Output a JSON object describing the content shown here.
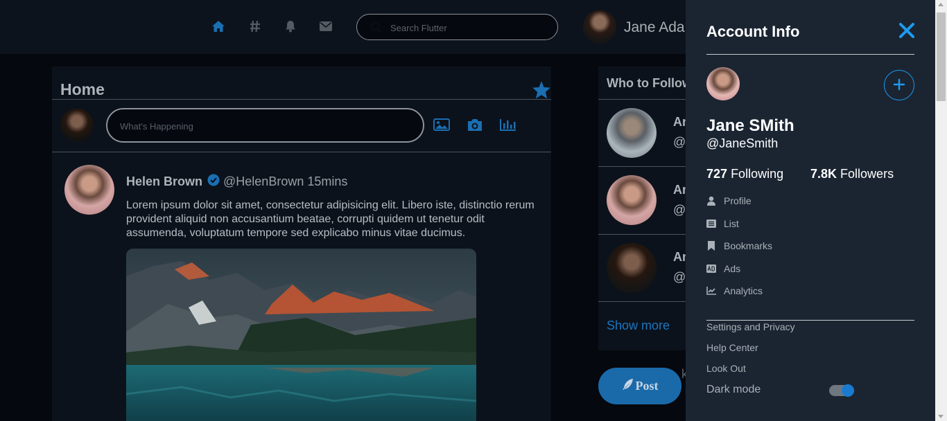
{
  "topbar": {
    "search": {
      "placeholder": "Search Flutter"
    },
    "user_name": "Jane Adams",
    "icons": [
      "home-icon",
      "hashtag-icon",
      "bell-icon",
      "envelope-icon",
      "search-icon"
    ]
  },
  "home": {
    "title": "Home",
    "compose_placeholder": "What's Happening",
    "compose_icons": [
      "image-icon",
      "camera-icon",
      "poll-icon"
    ],
    "post": {
      "name": "Helen Brown",
      "handle": "@HelenBrown",
      "time": "15mins",
      "text": "Lorem ipsum dolor sit amet, consectetur adipisicing elit. Libero iste, distinctio rerum provident aliquid non accusantium beatae, corrupti quidem ut tenetur odit assumenda, voluptatum tempore sed explicabo minus vitae ducimus."
    }
  },
  "who_to_follow": {
    "title": "Who to Follow",
    "items": [
      {
        "name": "An",
        "handle": "@"
      },
      {
        "name": "An",
        "handle": "@"
      },
      {
        "name": "An",
        "handle": "@"
      }
    ],
    "show_more": "Show more",
    "post_button": "Post",
    "peek_text": "k"
  },
  "drawer": {
    "title": "Account Info",
    "name": "Jane SMith",
    "handle": "@JaneSmith",
    "following_count": "727",
    "following_label": "Following",
    "followers_count": "7.8K",
    "followers_label": "Followers",
    "menu": [
      {
        "label": "Profile",
        "icon": "user-icon"
      },
      {
        "label": "List",
        "icon": "list-icon"
      },
      {
        "label": "Bookmarks",
        "icon": "bookmark-icon"
      },
      {
        "label": "Ads",
        "icon": "ad-icon"
      },
      {
        "label": "Analytics",
        "icon": "chart-line-icon"
      }
    ],
    "links": [
      "Settings and Privacy",
      "Help Center",
      "Look Out"
    ],
    "dark_mode_label": "Dark mode",
    "dark_mode_on": true
  },
  "colors": {
    "accent": "#1d9bf0",
    "background": "#05080e",
    "panel": "#0c121b",
    "drawer": "#1b2532"
  }
}
